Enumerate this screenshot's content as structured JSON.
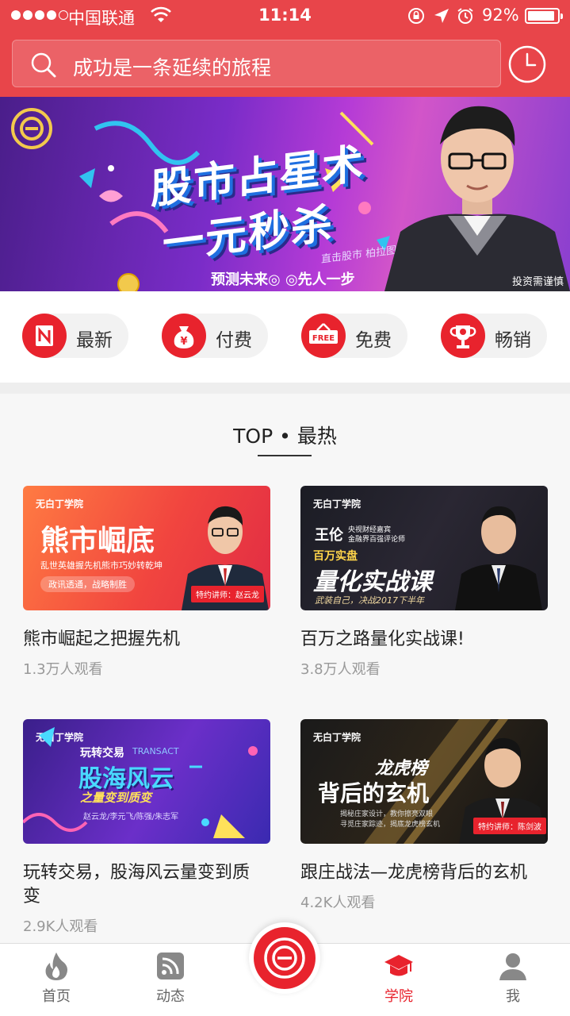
{
  "status_bar": {
    "carrier": "中国联通",
    "time": "11:14",
    "battery": "92%"
  },
  "search": {
    "placeholder": "成功是一条延续的旅程",
    "icon": "search-icon"
  },
  "header": {
    "history_icon": "clock-icon"
  },
  "banner": {
    "title_line1": "股市占星术",
    "title_line2": "一元秒杀",
    "tagline": "直击股市 柏拉图",
    "slogan": "预测未来◎ ◎先人一步",
    "disclaimer": "投资需谨慎"
  },
  "categories": [
    {
      "label": "最新",
      "icon": "new-badge-icon"
    },
    {
      "label": "付费",
      "icon": "money-bag-icon"
    },
    {
      "label": "免费",
      "icon": "free-tag-icon"
    },
    {
      "label": "畅销",
      "icon": "trophy-icon"
    }
  ],
  "section": {
    "title": "TOP • 最热"
  },
  "courses": [
    {
      "title": "熊市崛起之把握先机",
      "views": "1.3万人观看",
      "thumb": {
        "brand": "无白丁学院",
        "headline": "熊市崛底",
        "sub": "乱世英雄握先机熊市巧妙转乾坤",
        "pill": "政讯透通，战略制胜",
        "badge": "特约讲师：赵云龙"
      }
    },
    {
      "title": "百万之路量化实战课!",
      "views": "3.8万人观看",
      "thumb": {
        "brand": "无白丁学院",
        "name": "王伦",
        "role1": "央视财经嘉宾",
        "role2": "金融界百强评论师",
        "tag": "百万实盘",
        "headline": "量化实战课",
        "sub": "武装自己，决战2017下半年"
      }
    },
    {
      "title": "玩转交易，股海风云量变到质变",
      "views": "2.9K人观看",
      "thumb": {
        "brand": "无白丁学院",
        "kicker": "玩转交易",
        "kicker_en": "TRANSACT",
        "headline": "股海风云",
        "sub": "之量变到质变",
        "names": "赵云龙/李元飞/陈强/朱志军"
      }
    },
    {
      "title": "跟庄战法—龙虎榜背后的玄机",
      "views": "4.2K人观看",
      "thumb": {
        "brand": "无白丁学院",
        "headline1": "龙虎榜",
        "headline2": "背后的玄机",
        "desc1": "揭秘庄家设计，教你擦亮双眼",
        "desc2": "寻觅庄家踪迹，揭底龙虎榜玄机",
        "badge": "特约讲师：陈剑波"
      }
    }
  ],
  "tabbar": {
    "home": "首页",
    "feed": "动态",
    "academy": "学院",
    "me": "我",
    "active": "学院"
  },
  "colors": {
    "brand_red": "#e8232d",
    "header_red": "#e8454a",
    "muted_text": "#999999"
  }
}
